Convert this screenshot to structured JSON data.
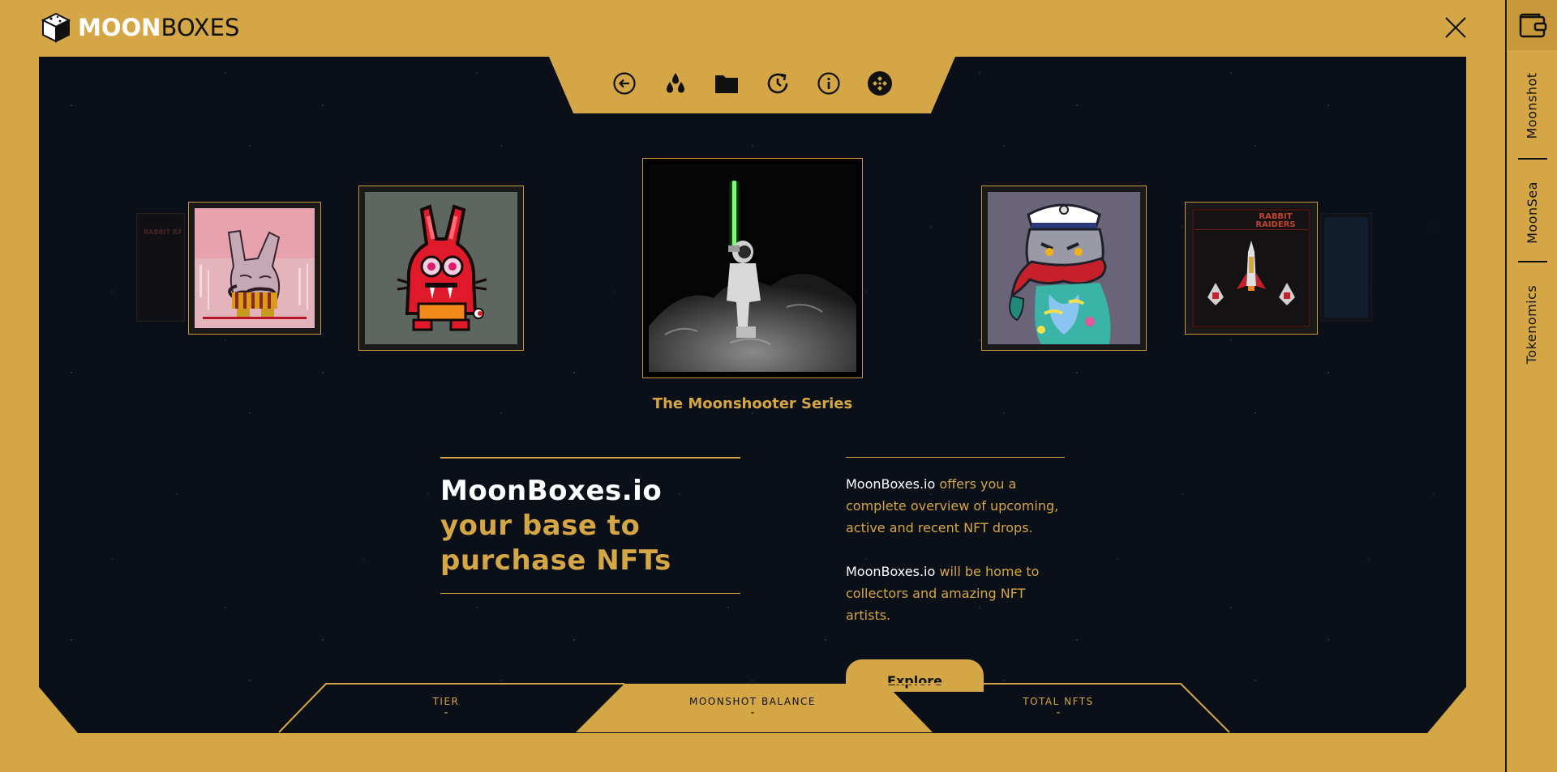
{
  "header": {
    "logo_part1": "MOON",
    "logo_part2": "BOXES",
    "close_label": "Close"
  },
  "rail": {
    "items": [
      "Moonshot",
      "MoonSea",
      "Tokenomics"
    ]
  },
  "nav": {
    "icons": [
      "back-icon",
      "drops-icon",
      "folder-icon",
      "history-icon",
      "info-icon",
      "binance-icon"
    ]
  },
  "carousel": {
    "active_title": "The Moonshooter Series",
    "cards": [
      {
        "label": "RABBIT RAIDERS"
      },
      {
        "label": "RABBIT RAIDERS"
      }
    ]
  },
  "hero": {
    "line1": "MoonBoxes.io",
    "line2": "your base to",
    "line3": "purchase NFTs"
  },
  "description": {
    "p1_brand": "MoonBoxes.io",
    "p1_rest": " offers you a complete overview of upcoming, active and recent NFT drops.",
    "p2_brand": "MoonBoxes.io",
    "p2_rest": " will be home to collectors and amazing NFT artists."
  },
  "explore_label": "Explore",
  "stats": {
    "tier_label": "TIER",
    "tier_value": "-",
    "balance_label": "MOONSHOT BALANCE",
    "balance_value": "-",
    "total_label": "TOTAL NFTS",
    "total_value": "-"
  },
  "colors": {
    "gold": "#d4a645",
    "space": "#0b0f18",
    "saber": "#39ff3a"
  }
}
